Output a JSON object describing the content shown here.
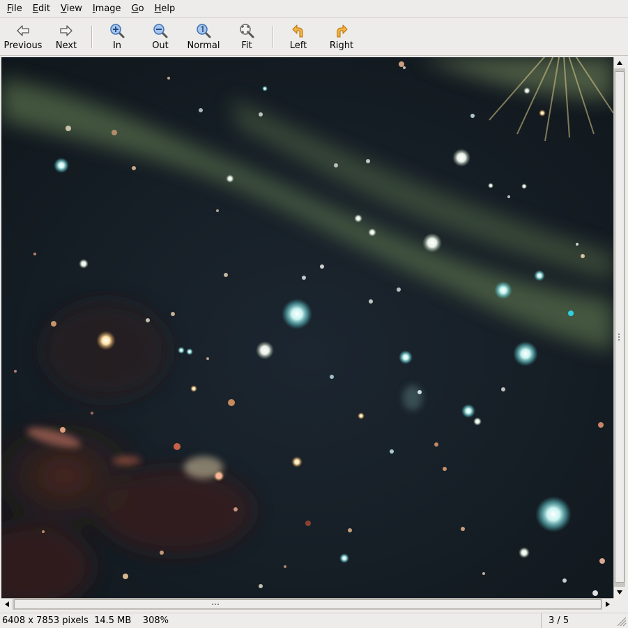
{
  "menu": {
    "file": {
      "key": "F",
      "rest": "ile"
    },
    "edit": {
      "key": "E",
      "rest": "dit"
    },
    "view": {
      "key": "V",
      "rest": "iew"
    },
    "image": {
      "key": "I",
      "rest": "mage"
    },
    "go": {
      "key": "G",
      "rest": "o"
    },
    "help": {
      "key": "H",
      "rest": "elp"
    }
  },
  "toolbar": {
    "previous": "Previous",
    "next": "Next",
    "zoom_in": "In",
    "zoom_out": "Out",
    "zoom_normal": "Normal",
    "zoom_fit": "Fit",
    "rotate_left": "Left",
    "rotate_right": "Right"
  },
  "icons": {
    "previous": "arrow-left-icon",
    "next": "arrow-right-icon",
    "zoom_in": "zoom-in-icon",
    "zoom_out": "zoom-out-icon",
    "zoom_normal": "zoom-100-icon",
    "zoom_fit": "zoom-fit-icon",
    "rotate_left": "rotate-left-icon",
    "rotate_right": "rotate-right-icon"
  },
  "statusbar": {
    "info": "6408 x 7853 pixels  14.5 MB    308%",
    "page": "3 / 5"
  },
  "colors": {
    "chrome": "#edeceb",
    "zoom_icon_blue": "#3f73b8",
    "rotate_icon_orange": "#e8a12a",
    "image_background": "#141c22"
  }
}
